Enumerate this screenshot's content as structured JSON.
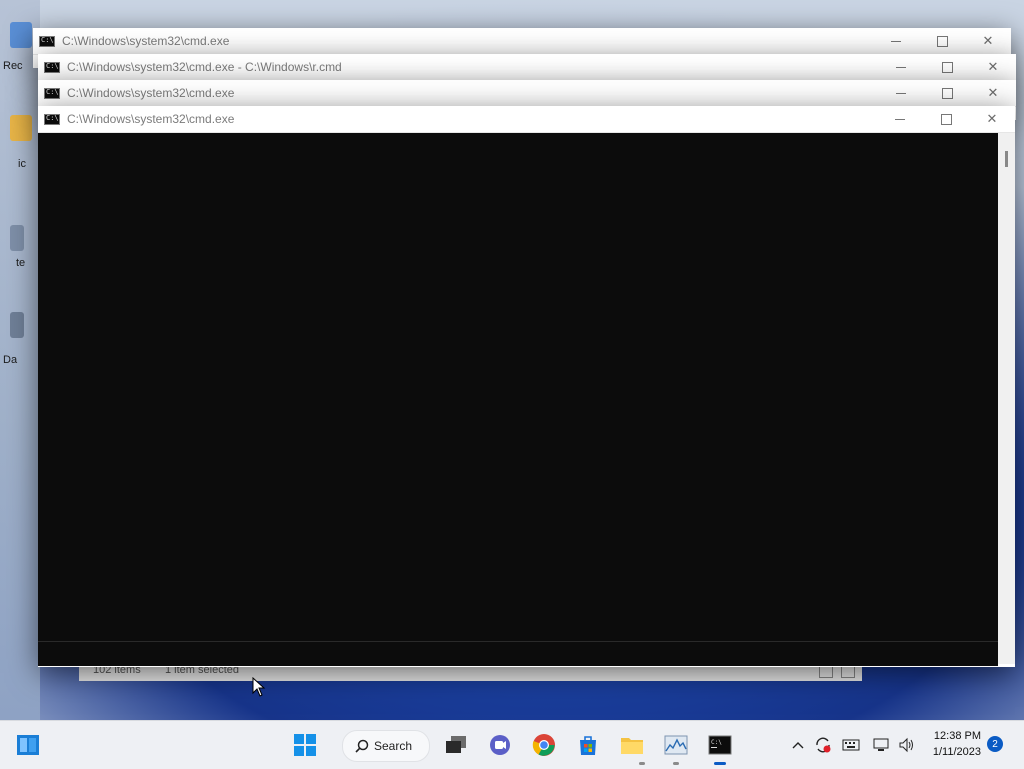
{
  "desktop": {
    "icons": [
      {
        "label": "Rec",
        "color": "#5a8fd6"
      },
      {
        "label": "ic",
        "color": "#e8b548"
      },
      {
        "label": "te",
        "color": "#7e8fa8"
      },
      {
        "label": "Da",
        "color": "#6f7f97"
      }
    ]
  },
  "explorer": {
    "status_items": "102 items",
    "status_selected": "1 item selected"
  },
  "windows": [
    {
      "title": "C:\\Windows\\system32\\cmd.exe"
    },
    {
      "title": "C:\\Windows\\system32\\cmd.exe - C:\\Windows\\r.cmd"
    },
    {
      "title": "C:\\Windows\\system32\\cmd.exe"
    },
    {
      "title": "C:\\Windows\\system32\\cmd.exe"
    }
  ],
  "taskbar": {
    "search_label": "Search",
    "time": "12:38 PM",
    "date": "1/11/2023",
    "notification_count": "2",
    "icons": [
      "widgets-icon",
      "start-icon",
      "search-icon",
      "task-view-icon",
      "chat-icon",
      "chrome-icon",
      "store-icon",
      "file-explorer-icon",
      "performance-monitor-icon",
      "terminal-icon"
    ],
    "tray_icons": [
      "chevron-up-icon",
      "sync-icon",
      "keyboard-icon",
      "network-icon",
      "volume-icon"
    ]
  },
  "colors": {
    "accent": "#0a5bc4",
    "console_bg": "#0c0c0c"
  }
}
